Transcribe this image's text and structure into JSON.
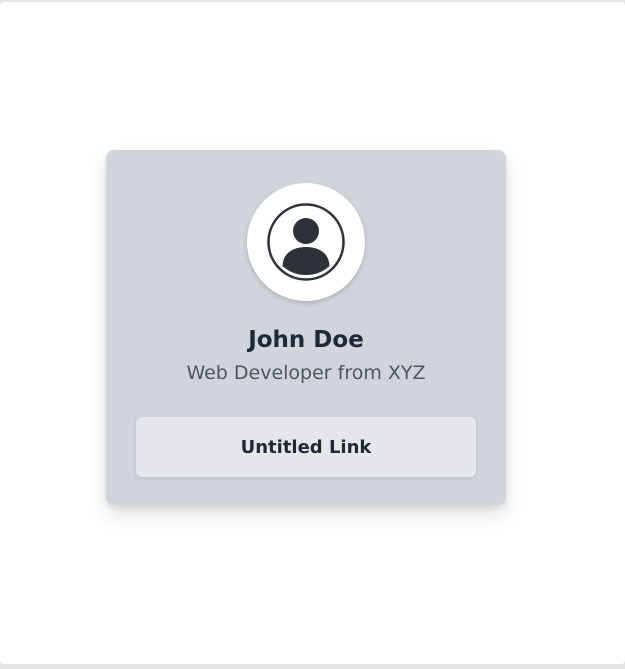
{
  "profile_card": {
    "avatar_icon": "user-circle-icon",
    "name": "John Doe",
    "subtitle": "Web Developer from XYZ",
    "link_label": "Untitled Link"
  },
  "colors": {
    "card_background": "#d1d5db",
    "button_background": "#e5e7eb",
    "text_primary": "#1f2937",
    "text_secondary": "#4b5563",
    "icon_color": "#2d3138"
  }
}
